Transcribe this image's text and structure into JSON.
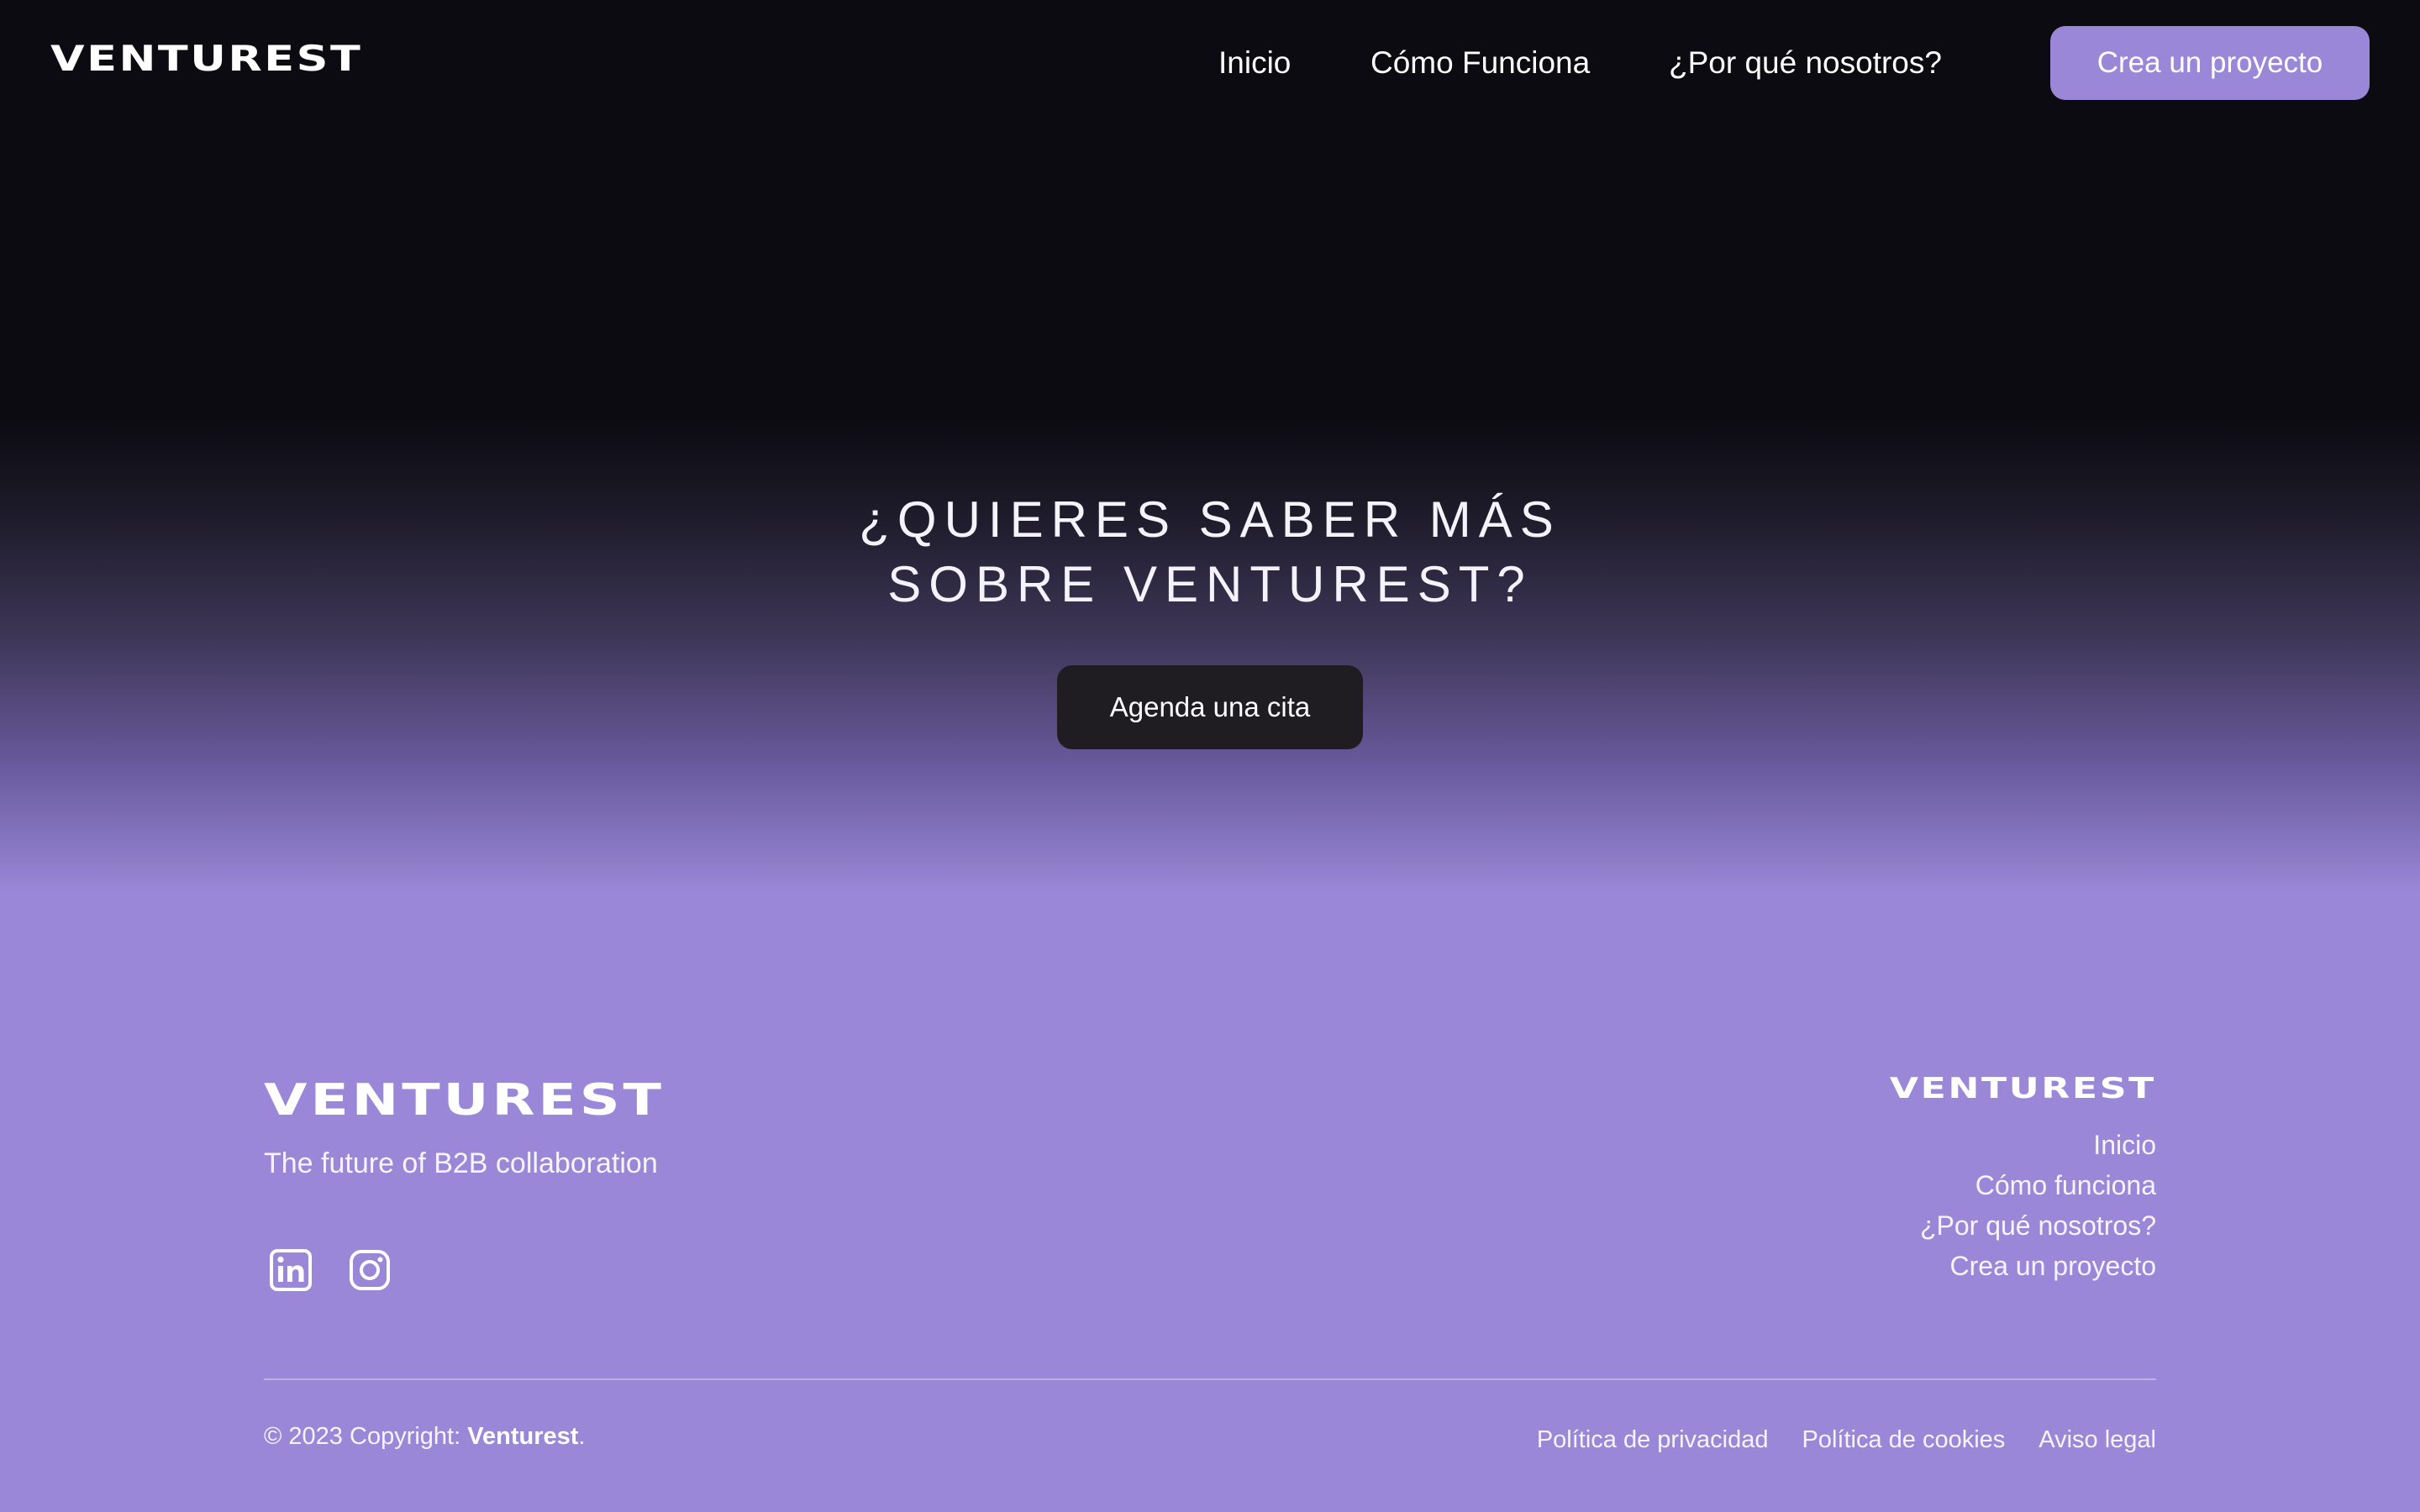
{
  "header": {
    "logo": "VENTUREST",
    "nav": [
      "Inicio",
      "Cómo Funciona",
      "¿Por qué nosotros?"
    ],
    "cta": "Crea un proyecto"
  },
  "hero": {
    "title_line1": "¿QUIERES SABER MÁS",
    "title_line2": "SOBRE VENTUREST?",
    "button": "Agenda una cita"
  },
  "footer": {
    "logo": "VENTUREST",
    "tagline": "The future of B2B collaboration",
    "social_icons": [
      "linkedin-icon",
      "instagram-icon"
    ],
    "right_logo": "VENTUREST",
    "links": [
      "Inicio",
      "Cómo funciona",
      "¿Por qué nosotros?",
      "Crea un proyecto"
    ],
    "copyright_prefix": "© 2023 Copyright: ",
    "copyright_brand": "Venturest",
    "copyright_suffix": ".",
    "legal": [
      "Política de privacidad",
      "Política de cookies",
      "Aviso legal"
    ]
  },
  "colors": {
    "accent": "#9a87d7",
    "dark": "#0c0b11",
    "button_dark": "#1f1d22"
  }
}
